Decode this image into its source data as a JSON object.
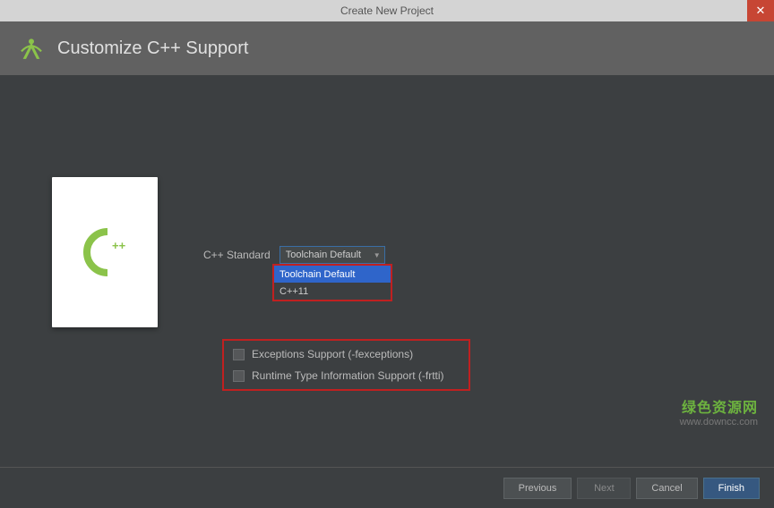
{
  "window": {
    "title": "Create New Project"
  },
  "header": {
    "title": "Customize C++ Support"
  },
  "preview": {
    "cpp_label": "C",
    "cpp_plus": "++"
  },
  "form": {
    "standard_label": "C++ Standard",
    "standard_value": "Toolchain Default",
    "standard_options": [
      "Toolchain Default",
      "C++11"
    ],
    "checkbox_exceptions": "Exceptions Support (-fexceptions)",
    "checkbox_rtti": "Runtime Type Information Support (-frtti)"
  },
  "buttons": {
    "previous": "Previous",
    "next": "Next",
    "cancel": "Cancel",
    "finish": "Finish"
  },
  "watermark": {
    "text_cn": "绿色资源网",
    "url": "www.downcc.com"
  },
  "colors": {
    "highlight_box": "#c02020",
    "selection_bg": "#2f65ca",
    "accent_green": "#8bc34a"
  }
}
